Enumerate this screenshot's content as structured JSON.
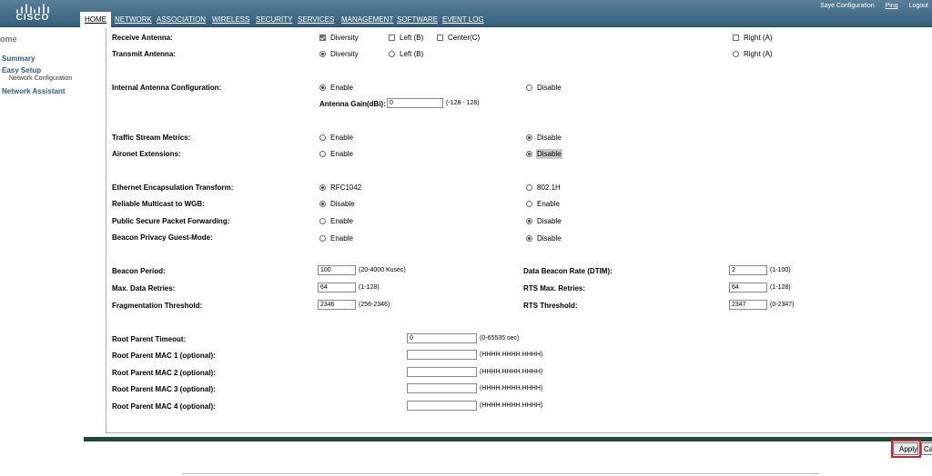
{
  "header": {
    "logo": "CISCO",
    "nav": [
      "HOME",
      "NETWORK",
      "ASSOCIATION",
      "WIRELESS",
      "SECURITY",
      "SERVICES",
      "MANAGEMENT",
      "SOFTWARE",
      "EVENT LOG"
    ],
    "links": {
      "save": "Saye Configuration",
      "ping": "Ping",
      "logout": "Logout"
    }
  },
  "sidebar": {
    "home": "ome",
    "summary": "Summary",
    "easy_setup": "Easy Setup",
    "network_configuration": "Network Configuration",
    "network_assistant": "Network Assistant"
  },
  "antenna": {
    "receive_label": "Receive Antenna:",
    "transmit_label": "Transmit Antenna:",
    "diversity": "Diversity",
    "left": "Left (B)",
    "center": "Center(C)",
    "right": "Right (A)",
    "internal_label": "Internal Antenna Configuration:",
    "enable": "Enable",
    "disable": "Disable",
    "gain_label": "Antenna Gain(dBi):",
    "gain_value": "0",
    "gain_range": "(-128 - 128)"
  },
  "traffic": {
    "tsm_label": "Traffic Stream Metrics:",
    "aironet_label": "Aironet Extensions:",
    "enable": "Enable",
    "disable": "Disable"
  },
  "ethernet": {
    "encap_label": "Ethernet Encapsulation Transform:",
    "rfc": "RFC1042",
    "dot1h": "802.1H",
    "multicast_label": "Reliable Multicast to WGB:",
    "pspf_label": "Public Secure Packet Forwarding:",
    "beacon_privacy_label": "Beacon Privacy Guest-Mode:",
    "enable": "Enable",
    "disable": "Disable"
  },
  "beacon": {
    "period_label": "Beacon Period:",
    "period_value": "100",
    "period_hint": "(20-4000 Kusec)",
    "dtim_label": "Data Beacon Rate (DTIM):",
    "dtim_value": "2",
    "dtim_hint": "(1-100)",
    "max_retries_label": "Max. Data Retries:",
    "max_retries_value": "64",
    "max_retries_hint": "(1-128)",
    "rts_retries_label": "RTS Max. Retries:",
    "rts_retries_value": "64",
    "rts_retries_hint": "(1-128)",
    "frag_label": "Fragmentation Threshold:",
    "frag_value": "2346",
    "frag_hint": "(256-2346)",
    "rts_threshold_label": "RTS Threshold:",
    "rts_threshold_value": "2347",
    "rts_threshold_hint": "(0-2347)"
  },
  "root_parent": {
    "timeout_label": "Root Parent Timeout:",
    "timeout_value": "0",
    "timeout_hint": "(0-65535 sec)",
    "mac1_label": "Root Parent MAC 1 (optional):",
    "mac2_label": "Root Parent MAC 2 (optional):",
    "mac3_label": "Root Parent MAC 3 (optional):",
    "mac4_label": "Root Parent MAC 4 (optional):",
    "mac_hint": "(HHHH.HHHH.HHHH)"
  },
  "footer": {
    "apply": "Apply",
    "cancel": "Ca"
  },
  "colors": {
    "header": "#34607c",
    "accent": "#2a5e87",
    "footer_bar": "#1f4a36",
    "highlight": "#d8222b"
  }
}
